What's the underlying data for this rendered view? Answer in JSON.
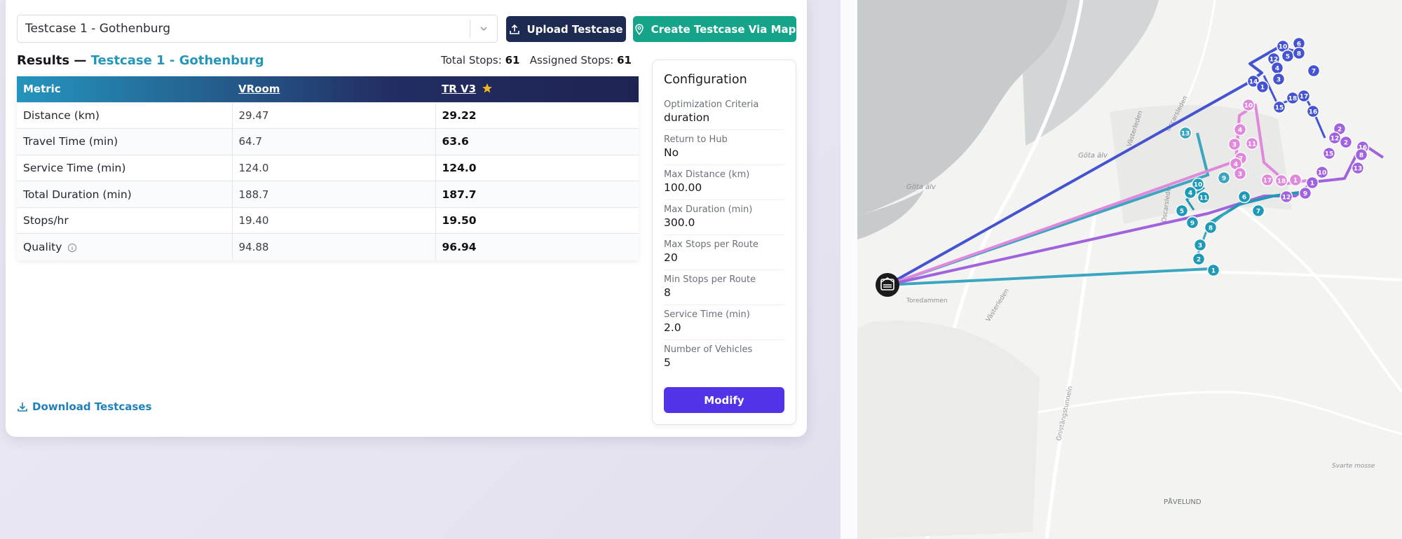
{
  "select": {
    "value": "Testcase 1 - Gothenburg"
  },
  "buttons": {
    "upload": "Upload Testcase",
    "create": "Create Testcase Via Map"
  },
  "results": {
    "prefix": "Results —",
    "name": "Testcase 1 - Gothenburg",
    "total_stops_label": "Total Stops:",
    "total_stops": "61",
    "assigned_stops_label": "Assigned Stops:",
    "assigned_stops": "61"
  },
  "table": {
    "headers": [
      "Metric",
      "VRoom",
      "TR V3"
    ],
    "rows": [
      [
        "Distance (km)",
        "29.47",
        "29.22"
      ],
      [
        "Travel Time (min)",
        "64.7",
        "63.6"
      ],
      [
        "Service Time (min)",
        "124.0",
        "124.0"
      ],
      [
        "Total Duration (min)",
        "188.7",
        "187.7"
      ],
      [
        "Stops/hr",
        "19.40",
        "19.50"
      ],
      [
        "Quality",
        "94.88",
        "96.94"
      ]
    ]
  },
  "download": "Download Testcases",
  "config": {
    "title": "Configuration",
    "items": [
      {
        "label": "Optimization Criteria",
        "value": "duration"
      },
      {
        "label": "Return to Hub",
        "value": "No"
      },
      {
        "label": "Max Distance (km)",
        "value": "100.00"
      },
      {
        "label": "Max Duration (min)",
        "value": "300.0"
      },
      {
        "label": "Max Stops per Route",
        "value": "20"
      },
      {
        "label": "Min Stops per Route",
        "value": "8"
      },
      {
        "label": "Service Time (min)",
        "value": "2.0"
      },
      {
        "label": "Number of Vehicles",
        "value": "5"
      }
    ],
    "modify": "Modify"
  },
  "map": {
    "labels": [
      "Göta älv",
      "Göta älv",
      "Toredammen",
      "Oscarsleden",
      "Västerleden",
      "Västerleden",
      "Oscarsleden",
      "Gnistängstunneln",
      "Svarte mosse",
      "PÅVELUND"
    ],
    "route_colors": [
      "#4553d1",
      "#3aa6c0",
      "#e089dc",
      "#a063dd",
      "#1f9ab6"
    ],
    "stops": [
      "10",
      "6",
      "12",
      "5",
      "8",
      "4",
      "7",
      "3",
      "14",
      "1",
      "18",
      "17",
      "15",
      "16",
      "13",
      "9",
      "4",
      "10",
      "11",
      "3",
      "7",
      "4",
      "3",
      "17",
      "18",
      "1",
      "16",
      "2",
      "13",
      "8",
      "2",
      "12",
      "15",
      "10",
      "1",
      "9",
      "12",
      "10",
      "11",
      "4",
      "5",
      "9",
      "8",
      "6",
      "7",
      "3",
      "2",
      "1"
    ]
  }
}
